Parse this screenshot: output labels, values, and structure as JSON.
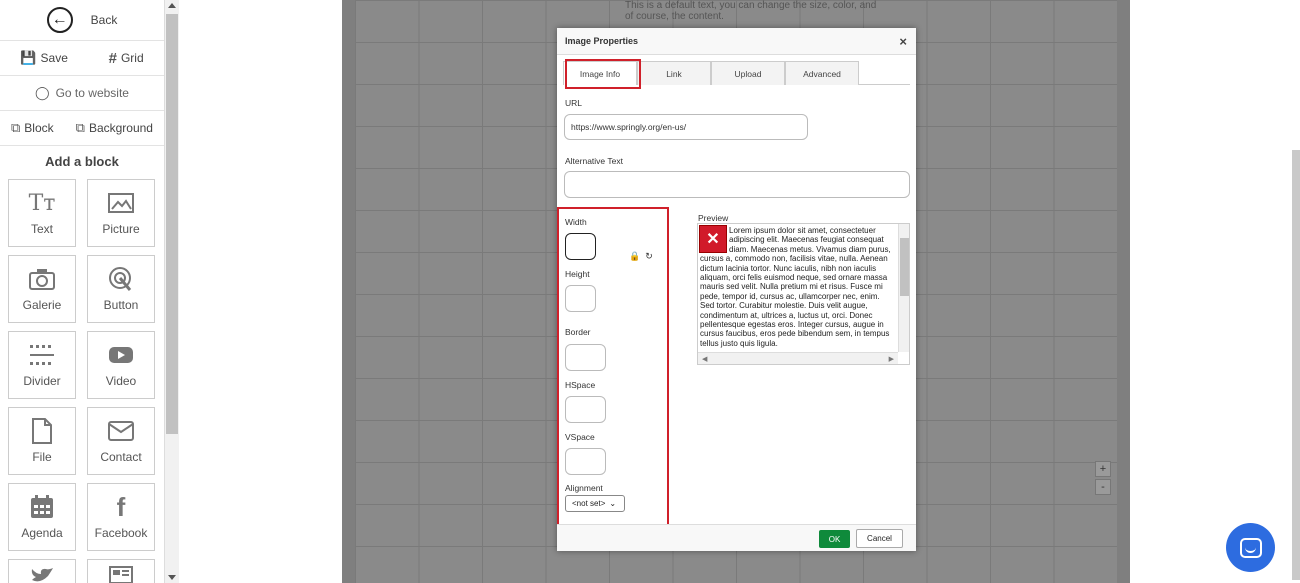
{
  "sidebar": {
    "back_label": "Back",
    "save_label": "Save",
    "grid_label": "Grid",
    "website_label": "Go to website",
    "block_label": "Block",
    "background_label": "Background",
    "add_block_title": "Add a block",
    "blocks": [
      "Text",
      "Picture",
      "Galerie",
      "Button",
      "Divider",
      "Video",
      "File",
      "Contact",
      "Agenda",
      "Facebook"
    ]
  },
  "canvas": {
    "default_text": "This is a default text, you can change the size, color, and of course, the content.",
    "zoom_in": "+",
    "zoom_out": "-"
  },
  "dialog": {
    "title": "Image Properties",
    "close": "×",
    "tabs": [
      "Image Info",
      "Link",
      "Upload",
      "Advanced"
    ],
    "active_tab": "Image Info",
    "url_label": "URL",
    "url_value": "https://www.springly.org/en-us/",
    "alt_label": "Alternative Text",
    "alt_value": "",
    "width_label": "Width",
    "height_label": "Height",
    "border_label": "Border",
    "hspace_label": "HSpace",
    "vspace_label": "VSpace",
    "alignment_label": "Alignment",
    "alignment_value": "<not set>",
    "preview_label": "Preview",
    "preview_text": "Lorem ipsum dolor sit amet, consectetuer adipiscing elit. Maecenas feugiat consequat diam. Maecenas metus. Vivamus diam purus, cursus a, commodo non, facilisis vitae, nulla. Aenean dictum lacinia tortor. Nunc iaculis, nibh non iaculis aliquam, orci felis euismod neque, sed ornare massa mauris sed velit. Nulla pretium mi et risus. Fusce mi pede, tempor id, cursus ac, ullamcorper nec, enim. Sed tortor. Curabitur molestie. Duis velit augue, condimentum at, ultrices a, luctus ut, orci. Donec pellentesque egestas eros. Integer cursus, augue in cursus faucibus, eros pede bibendum sem, in tempus tellus justo quis ligula.",
    "ok_label": "OK",
    "cancel_label": "Cancel"
  },
  "colors": {
    "highlight": "#d0202a",
    "ok_button": "#0f8a3b",
    "chat_bubble": "#2d6ce0"
  }
}
